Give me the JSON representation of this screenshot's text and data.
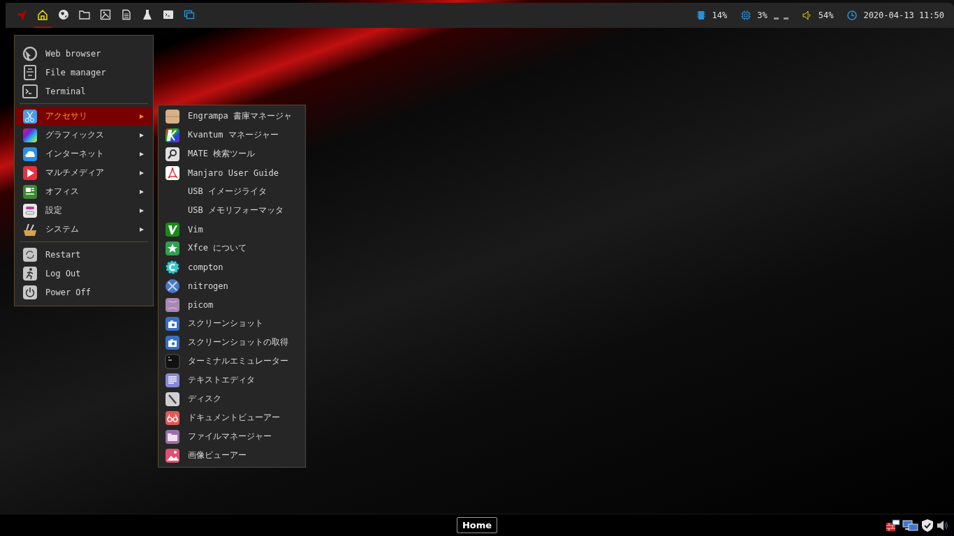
{
  "top_panel": {
    "launchers": [
      {
        "selected": false
      },
      {
        "selected": true
      },
      {
        "selected": false
      },
      {
        "selected": false
      },
      {
        "selected": false
      },
      {
        "selected": false
      },
      {
        "selected": false
      },
      {
        "selected": false
      },
      {
        "selected": false
      }
    ],
    "memory": "14%",
    "cpu": "3%",
    "volume": "54%",
    "clock": "2020-04-13 11:50"
  },
  "menu": {
    "sections": [
      {
        "items": [
          {
            "label": "Web browser",
            "submenu": false,
            "selected": false
          },
          {
            "label": "File manager",
            "submenu": false,
            "selected": false
          },
          {
            "label": "Terminal",
            "submenu": false,
            "selected": false
          }
        ]
      },
      {
        "items": [
          {
            "label": "アクセサリ",
            "submenu": true,
            "selected": true
          },
          {
            "label": "グラフィックス",
            "submenu": true,
            "selected": false
          },
          {
            "label": "インターネット",
            "submenu": true,
            "selected": false
          },
          {
            "label": "マルチメディア",
            "submenu": true,
            "selected": false
          },
          {
            "label": "オフィス",
            "submenu": true,
            "selected": false
          },
          {
            "label": "設定",
            "submenu": true,
            "selected": false
          },
          {
            "label": "システム",
            "submenu": true,
            "selected": false
          }
        ]
      },
      {
        "items": [
          {
            "label": "Restart",
            "submenu": false,
            "selected": false
          },
          {
            "label": "Log Out",
            "submenu": false,
            "selected": false
          },
          {
            "label": "Power Off",
            "submenu": false,
            "selected": false
          }
        ]
      }
    ]
  },
  "submenu": {
    "items": [
      {
        "label": "Engrampa 書庫マネージャ"
      },
      {
        "label": "Kvantum マネージャー"
      },
      {
        "label": "MATE 検索ツール"
      },
      {
        "label": "Manjaro User Guide"
      },
      {
        "label": "USB イメージライタ"
      },
      {
        "label": "USB メモリフォーマッタ"
      },
      {
        "label": "Vim"
      },
      {
        "label": "Xfce について"
      },
      {
        "label": "compton"
      },
      {
        "label": "nitrogen"
      },
      {
        "label": "picom"
      },
      {
        "label": "スクリーンショット"
      },
      {
        "label": "スクリーンショットの取得"
      },
      {
        "label": "ターミナルエミュレーター"
      },
      {
        "label": "テキストエディタ"
      },
      {
        "label": "ディスク"
      },
      {
        "label": "ドキュメントビューアー"
      },
      {
        "label": "ファイルマネージャー"
      },
      {
        "label": "画像ビューアー"
      }
    ]
  },
  "bottom_panel": {
    "button": "Home"
  }
}
